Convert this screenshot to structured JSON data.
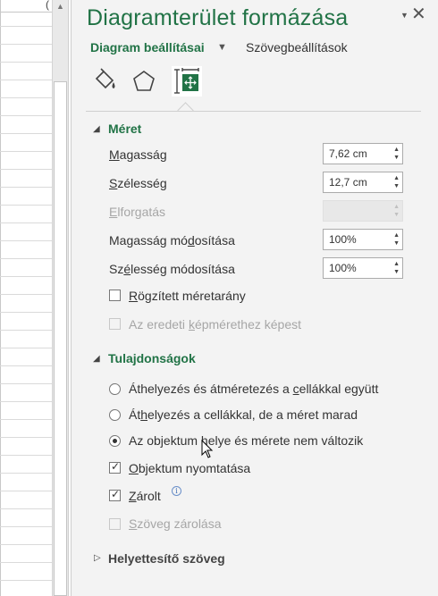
{
  "sheet": {
    "header_glyph": "("
  },
  "pane": {
    "title": "Diagramterület formázása",
    "tabs": {
      "active": "Diagram beállításai",
      "other": "Szövegbeállítások"
    },
    "icons": [
      "fill-line-icon",
      "effects-icon",
      "size-properties-icon"
    ],
    "colors": {
      "accent": "#217346",
      "pane_bg": "#f3f3f3"
    }
  },
  "size": {
    "title": "Méret",
    "height_label": {
      "pre": "",
      "u": "M",
      "post": "agasság"
    },
    "height_value": "7,62 cm",
    "width_label": {
      "pre": "",
      "u": "S",
      "post": "zélesség"
    },
    "width_value": "12,7 cm",
    "rotation_label": {
      "pre": "",
      "u": "E",
      "post": "lforgatás"
    },
    "rotation_value": "",
    "scale_height_label": {
      "pre": "Magasság mó",
      "u": "d",
      "post": "osítása"
    },
    "scale_height_value": "100%",
    "scale_width_label": {
      "pre": "Sz",
      "u": "é",
      "post": "lesség módosítása"
    },
    "scale_width_value": "100%",
    "lock_aspect_label": {
      "pre": "",
      "u": "R",
      "post": "ögzített méretarány"
    },
    "lock_aspect_checked": false,
    "relative_original_label": {
      "pre": "Az eredeti ",
      "u": "k",
      "post": "épmérethez képest"
    },
    "relative_original_checked": false
  },
  "properties": {
    "title": "Tulajdonságok",
    "option1": {
      "pre": "Áthelyezés és átméretezés a ",
      "u": "c",
      "post": "ellákkal együtt"
    },
    "option2": {
      "pre": "Át",
      "u": "h",
      "post": "elyezés a cellákkal, de a méret marad"
    },
    "option3": {
      "pre": "Az objektum helye és mérete nem változik",
      "u": "",
      "post": ""
    },
    "selected_option": 3,
    "print_label": {
      "pre": "",
      "u": "O",
      "post": "bjektum nyomtatása"
    },
    "print_checked": true,
    "locked_label": {
      "pre": "",
      "u": "Z",
      "post": "árolt"
    },
    "locked_checked": true,
    "lock_text_label": {
      "pre": "",
      "u": "S",
      "post": "zöveg zárolása"
    },
    "lock_text_checked": false
  },
  "alt_text": {
    "title": "Helyettesítő szöveg"
  }
}
